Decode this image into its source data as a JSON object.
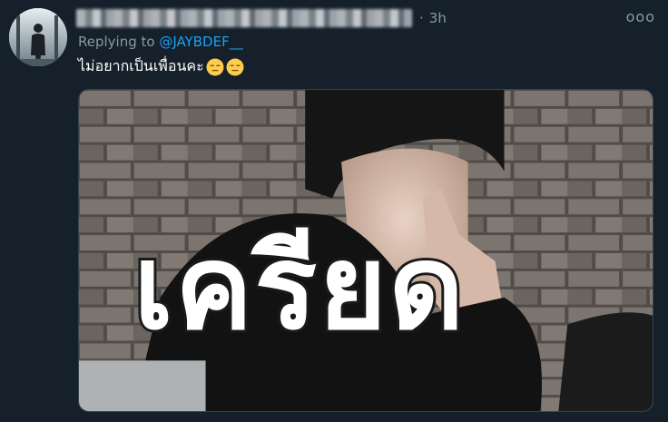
{
  "tweet": {
    "time_separator": "·",
    "time": "3h",
    "more_label": "ooo",
    "replying_prefix": "Replying to ",
    "replying_handle": "@JAYBDEF__",
    "text": "ไม่อยากเป็นเพื่อนคะ",
    "emojis": [
      "expressionless-face-icon",
      "expressionless-face-icon"
    ],
    "media": {
      "caption": "เครียด",
      "icon": "photo-meme"
    }
  },
  "colors": {
    "background": "#15202b",
    "secondary_text": "#8899a6",
    "link": "#1da1f2",
    "primary_text": "#ffffff",
    "emoji": "#ffcc4d"
  }
}
